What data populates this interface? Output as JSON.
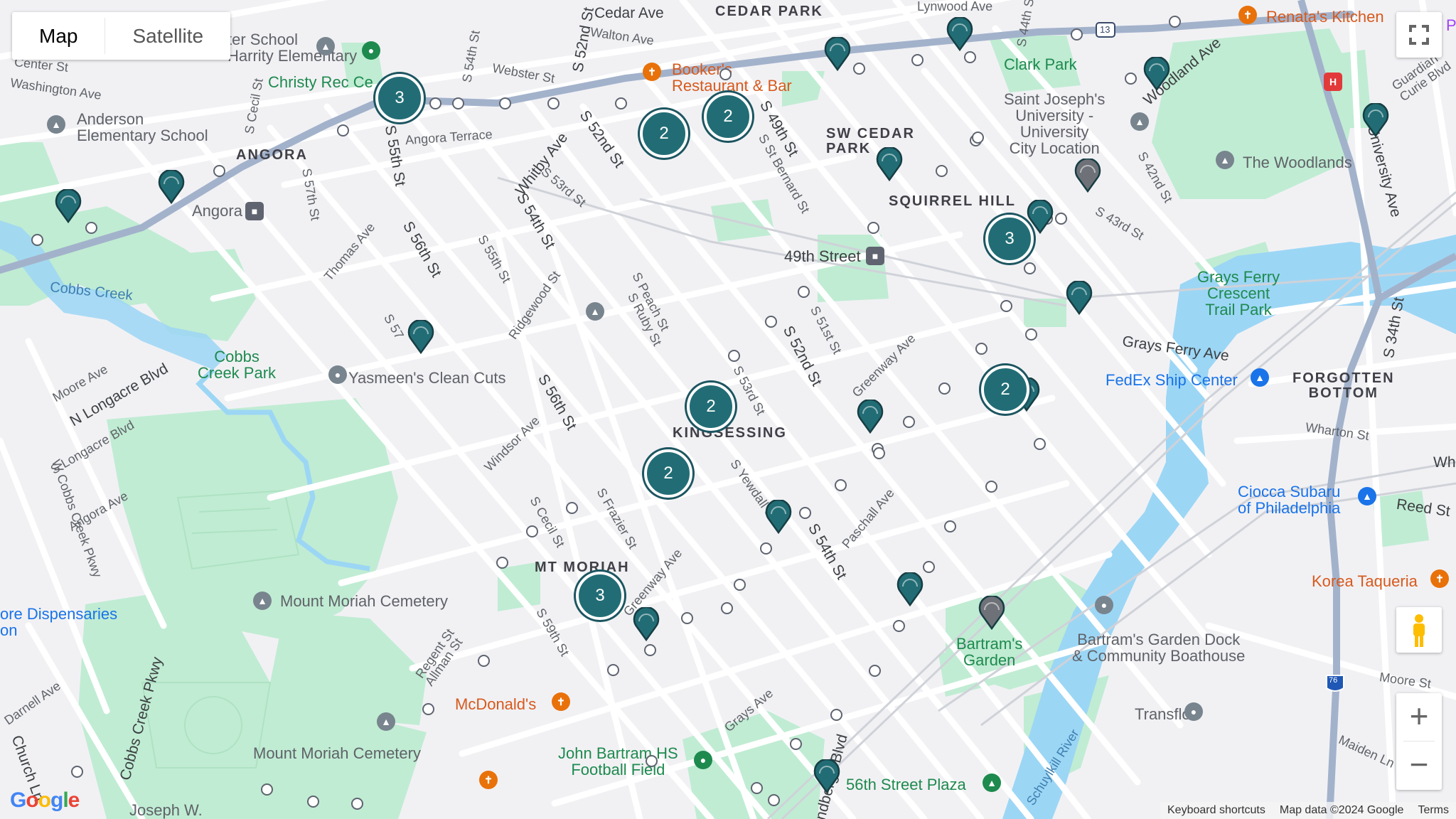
{
  "map_type": {
    "map": "Map",
    "satellite": "Satellite",
    "selected": "Map"
  },
  "controls": {
    "fullscreen_icon": "fullscreen-icon",
    "zoom_in": "+",
    "zoom_out": "−",
    "pegman_icon": "pegman-icon"
  },
  "attribution": {
    "keyboard": "Keyboard shortcuts",
    "mapdata": "Map data ©2024 Google",
    "terms": "Terms"
  },
  "logo": "Google",
  "areas": {
    "cedar_park": "CEDAR PARK",
    "angora": "ANGORA",
    "sw_cedar_park": "SW CEDAR\nPARK",
    "squirrel_hill": "SQUIRREL HILL",
    "kingsessing": "KINGSESSING",
    "mt_moriah": "MT MORIAH",
    "forgotten_bottom": "FORGOTTEN\nBOTTOM"
  },
  "parks": {
    "christy": "Christy Rec Ce",
    "clark": "Clark Park",
    "woodlands": "The Woodlands",
    "cobbs_creek_park": "Cobbs\nCreek Park",
    "grays_ferry": "Grays Ferry\nCrescent\nTrail Park",
    "bartrams": "Bartram's\nGarden",
    "football": "John Bartram HS\nFootball Field",
    "plaza": "56th Street Plaza"
  },
  "pois": {
    "school1": "ter School\nHarrity Elementary",
    "anderson": "Anderson\nElementary School",
    "angora_station": "Angora",
    "booker": "Booker's\nRestaurant & Bar",
    "renata": "Renata's Kitchen",
    "saint_joseph": "Saint Joseph's\nUniversity -\nUniversity\nCity Location",
    "station49": "49th Street",
    "yasmeen": "Yasmeen's Clean Cuts",
    "fedex": "FedEx Ship Center",
    "ciocca": "Ciocca Subaru\nof Philadelphia",
    "korea": "Korea Taqueria",
    "mount_moriah1": "Mount Moriah Cemetery",
    "mount_moriah2": "Mount Moriah Cemetery",
    "mcdonalds": "McDonald's",
    "dock": "Bartram's Garden Dock\n& Community Boathouse",
    "transflo": "Transflo",
    "dispensaries": "ore Dispensaries\non",
    "joseph_w": "Joseph W."
  },
  "water": {
    "cobbs_creek": "Cobbs Creek",
    "schuylkill": "Schuylkill River"
  },
  "streets": {
    "cedar_ave": "Cedar Ave",
    "walton": "Walton Ave",
    "webster": "Webster St",
    "washington": "Washington Ave",
    "angora_terrace": "Angora Terrace",
    "s55": "S 55th St",
    "s56": "S 56th St",
    "s57": "S 57th St",
    "s54": "S 54th St",
    "s53": "S 53rd St",
    "s52": "S 52nd St",
    "s49": "S 49th St",
    "s_bernard": "S St Bernard St",
    "whitby": "Whitby Ave",
    "thomas": "Thomas Ave",
    "s55b": "S 55th St",
    "ridgewood": "Ridgewood St",
    "s_peach": "S Peach St",
    "s_ruby": "S Ruby St",
    "s51": "S 51st St",
    "s52b": "S 52nd St",
    "greenway": "Greenway Ave",
    "s43": "S 43rd St",
    "s42": "S 42nd St",
    "woodland": "Woodland Ave",
    "university": "University Ave",
    "guardian": "Guardian\nCurie Blvd",
    "grays_ferry_ave": "Grays Ferry Ave",
    "s34": "S 34th St",
    "wharton": "Wharton St",
    "wharton2": "Whart",
    "reed": "Reed St",
    "moore": "Moore St",
    "maiden": "Maiden Ln",
    "moore_ave": "Moore Ave",
    "longacre": "N Longacre Blvd",
    "s_longacre": "S Longacre Blvd",
    "w_cobbs": "W Cobbs Creek Pkwy",
    "angora_ave": "Angora Ave",
    "cobbs_pkwy": "Cobbs Creek Pkwy",
    "darnell": "Darnell Ave",
    "church": "Church Ln",
    "regent": "Regent St",
    "allman": "Allman St",
    "s59": "S 59th St",
    "s_cecil": "S Cecil St",
    "s_frazier": "S Frazier St",
    "greenway2": "Greenway Ave",
    "windsor": "Windsor Ave",
    "s56b": "S 56th St",
    "s53b": "S 53rd St",
    "s_yewdall": "S Yewdall St",
    "s54b": "S 54th St",
    "paschall": "Paschall Ave",
    "grays_ave": "Grays Ave",
    "lindbergh": "Lindbergh Blvd",
    "s_cecil_top": "S Cecil St",
    "s54_top": "S 54th St",
    "s52_top": "S 52nd St",
    "s44": "S 44th St",
    "s52_mid": "S 52nd St",
    "s57_mid": "S 57",
    "s53_top": "S 53rd St",
    "pnt": "P",
    "hwy13": "13",
    "hwy76": "76",
    "s_center": "Center St",
    "lynwood": "Lynwood Ave"
  },
  "clusters": [
    "3",
    "2",
    "2",
    "2",
    "3",
    "2",
    "2",
    "3"
  ],
  "colors": {
    "teal": "#226d75",
    "green": "#c0ecd3",
    "water": "#9cd6f5",
    "road": "#ffffff",
    "arterial": "#a3b2cb"
  }
}
